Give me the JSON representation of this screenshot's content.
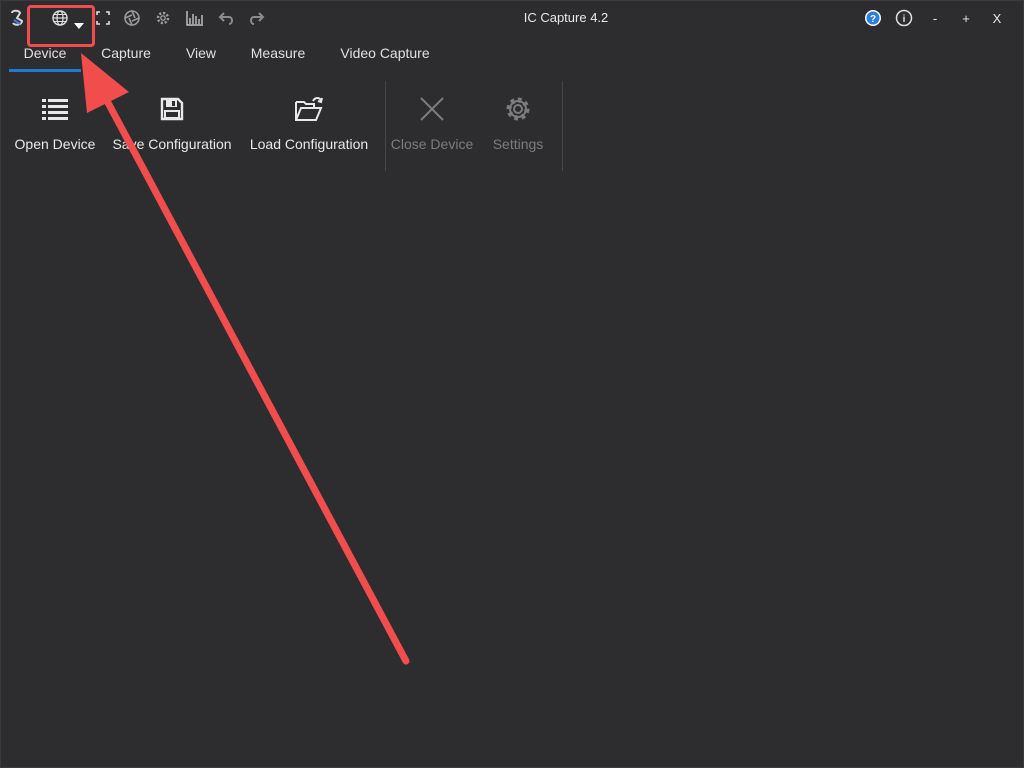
{
  "window": {
    "title": "IC Capture 4.2"
  },
  "quick_access": {
    "icons": [
      "app-logo-icon",
      "globe-language-icon",
      "dropdown-arrow-icon",
      "fullscreen-icon",
      "aperture-icon",
      "gear-icon",
      "histogram-icon",
      "undo-icon",
      "redo-icon"
    ]
  },
  "window_controls": {
    "help_label": "?",
    "info_label": "i",
    "minimize_label": "-",
    "maximize_label": "+",
    "close_label": "X"
  },
  "tabs": [
    {
      "label": "Device",
      "active": true
    },
    {
      "label": "Capture",
      "active": false
    },
    {
      "label": "View",
      "active": false
    },
    {
      "label": "Measure",
      "active": false
    },
    {
      "label": "Video Capture",
      "active": false
    }
  ],
  "ribbon": {
    "buttons": [
      {
        "label": "Open Device",
        "icon": "list-icon",
        "enabled": true
      },
      {
        "label": "Save Configuration",
        "icon": "floppy-disk-icon",
        "enabled": true
      },
      {
        "label": "Load Configuration",
        "icon": "open-folder-icon",
        "enabled": true
      },
      {
        "label": "Close Device",
        "icon": "close-x-icon",
        "enabled": false
      },
      {
        "label": "Settings",
        "icon": "gear-icon",
        "enabled": false
      }
    ]
  },
  "colors": {
    "background": "#2d2d30",
    "accent": "#1e7bd1",
    "annotation": "#f24d4d",
    "text": "#e8e8e8",
    "disabled_text": "#7c7c7e"
  }
}
